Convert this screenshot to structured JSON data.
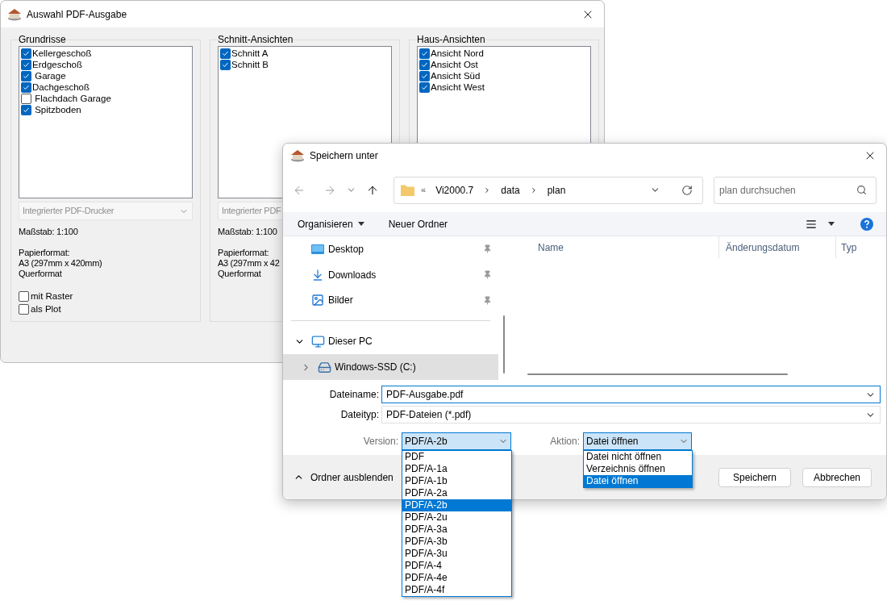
{
  "back_window": {
    "title": "Auswahl PDF-Ausgabe",
    "groups": [
      {
        "title": "Grundrisse",
        "items": [
          {
            "label": "Kellergeschoß",
            "checked": true
          },
          {
            "label": "Erdgeschoß",
            "checked": true
          },
          {
            "label": " Garage",
            "checked": true
          },
          {
            "label": "Dachgeschoß",
            "checked": true
          },
          {
            "label": " Flachdach Garage",
            "checked": false
          },
          {
            "label": " Spitzboden",
            "checked": true
          }
        ],
        "printer": "Integrierter PDF-Drucker",
        "scale": "Maßstab: 1:100",
        "paper_label": "Papierformat:",
        "paper_size": "A3 (297mm x 420mm)",
        "orientation": "Querformat",
        "options": [
          {
            "label": "mit Raster",
            "checked": false
          },
          {
            "label": "als Plot",
            "checked": false
          }
        ]
      },
      {
        "title": "Schnitt-Ansichten",
        "items": [
          {
            "label": "Schnitt A",
            "checked": true
          },
          {
            "label": "Schnitt B",
            "checked": true
          }
        ],
        "printer": "Integrierter PDF",
        "scale": "Maßstab: 1:100",
        "paper_label": "Papierformat:",
        "paper_size": "A3 (297mm x 42",
        "orientation": "Querformat"
      },
      {
        "title": "Haus-Ansichten",
        "items": [
          {
            "label": "Ansicht Nord",
            "checked": true
          },
          {
            "label": "Ansicht Ost",
            "checked": true
          },
          {
            "label": "Ansicht Süd",
            "checked": true
          },
          {
            "label": "Ansicht West",
            "checked": true
          }
        ]
      }
    ]
  },
  "save_dialog": {
    "title": "Speichern unter",
    "address": {
      "overflow_marker": "«",
      "breadcrumb": [
        "Vi2000.7",
        "data",
        "plan"
      ]
    },
    "search": {
      "placeholder": "plan durchsuchen"
    },
    "toolbar": {
      "organize": "Organisieren",
      "new_folder": "Neuer Ordner"
    },
    "nav_items": [
      {
        "label": "Desktop",
        "kind": "desktop",
        "pinned": true,
        "selected": false
      },
      {
        "label": "Downloads",
        "kind": "downloads",
        "pinned": true,
        "selected": false
      },
      {
        "label": "Bilder",
        "kind": "pictures",
        "pinned": true,
        "selected": false
      },
      {
        "label": "Dieser PC",
        "kind": "pc",
        "pinned": false,
        "selected": false,
        "expanded": true,
        "children": [
          {
            "label": "Windows-SSD (C:)",
            "kind": "drive",
            "pinned": false,
            "selected": true,
            "expanded": false
          }
        ]
      }
    ],
    "columns": [
      "Name",
      "Änderungsdatum",
      "Typ"
    ],
    "filename": {
      "label": "Dateiname:",
      "value": "PDF-Ausgabe.pdf"
    },
    "filetype": {
      "label": "Dateityp:",
      "value": "PDF-Dateien (*.pdf)"
    },
    "version": {
      "label": "Version:",
      "value": "PDF/A-2b",
      "options": [
        {
          "label": "PDF",
          "selected": false
        },
        {
          "label": "PDF/A-1a",
          "selected": false
        },
        {
          "label": "PDF/A-1b",
          "selected": false
        },
        {
          "label": "PDF/A-2a",
          "selected": false
        },
        {
          "label": "PDF/A-2b",
          "selected": true
        },
        {
          "label": "PDF/A-2u",
          "selected": false
        },
        {
          "label": "PDF/A-3a",
          "selected": false
        },
        {
          "label": "PDF/A-3b",
          "selected": false
        },
        {
          "label": "PDF/A-3u",
          "selected": false
        },
        {
          "label": "PDF/A-4",
          "selected": false
        },
        {
          "label": "PDF/A-4e",
          "selected": false
        },
        {
          "label": "PDF/A-4f",
          "selected": false
        }
      ]
    },
    "action": {
      "label": "Aktion:",
      "value": "Datei öffnen",
      "options": [
        {
          "label": "Datei nicht öffnen",
          "selected": false
        },
        {
          "label": "Verzeichnis öffnen",
          "selected": false
        },
        {
          "label": "Datei öffnen",
          "selected": true
        }
      ]
    },
    "hide_folders": "Ordner ausblenden",
    "buttons": [
      "Speichern",
      "Abbrechen"
    ]
  }
}
